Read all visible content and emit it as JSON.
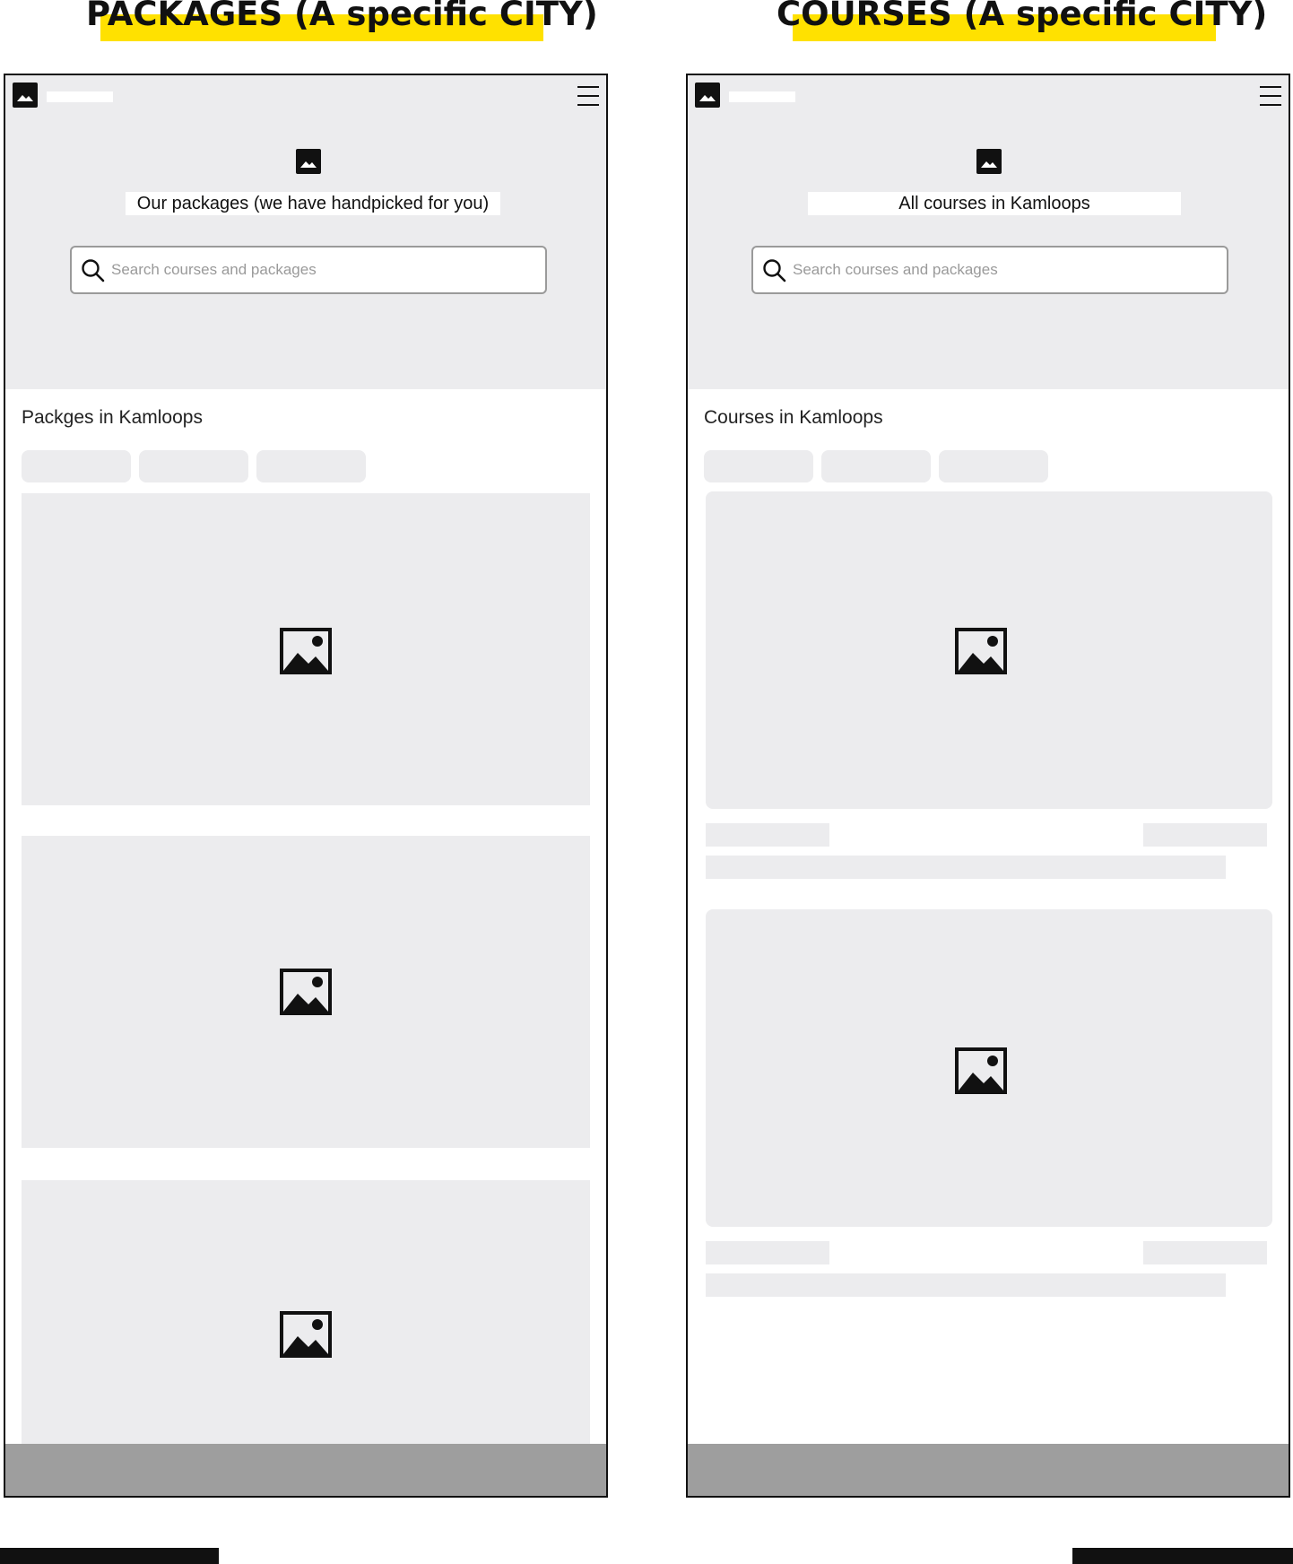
{
  "left_frame": {
    "title": "PACKAGES (A specific CITY)",
    "hero_title": "Our packages (we have handpicked for you)",
    "search_placeholder": "Search courses and packages",
    "section_heading": "Packges in Kamloops"
  },
  "right_frame": {
    "title": "COURSES (A specific CITY)",
    "hero_title": "All courses in Kamloops",
    "search_placeholder": "Search courses and packages",
    "section_heading": "Courses  in Kamloops"
  },
  "icons": {
    "logo": "image-placeholder-icon",
    "menu": "hamburger-menu-icon",
    "search": "search-icon",
    "card_image": "image-placeholder-icon"
  },
  "colors": {
    "highlight": "#ffe100",
    "hero_bg": "#ececee",
    "footer_bg": "#9e9e9e",
    "placeholder_text": "#9a9a9a"
  }
}
